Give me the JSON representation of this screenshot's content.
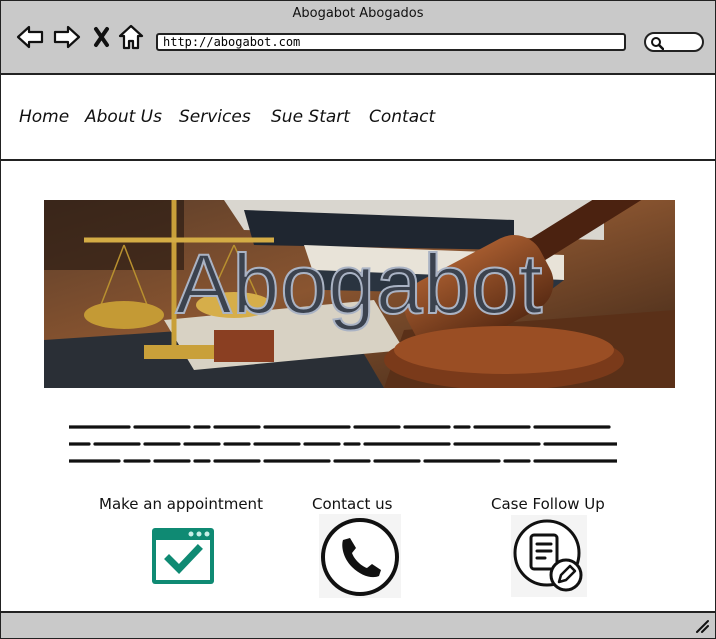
{
  "window": {
    "title": "Abogabot Abogados"
  },
  "toolbar": {
    "back_icon": "arrow-left-icon",
    "forward_icon": "arrow-right-icon",
    "stop_icon": "x-icon",
    "home_icon": "home-icon",
    "url": "http://abogabot.com",
    "search_icon": "search-icon"
  },
  "menu": {
    "items": [
      {
        "label": "Home"
      },
      {
        "label": "About Us"
      },
      {
        "label": "Services"
      },
      {
        "label": "Sue Start"
      },
      {
        "label": "Contact"
      }
    ]
  },
  "hero": {
    "title": "Abogabot",
    "image": "scales-of-justice-books-gavel"
  },
  "features": [
    {
      "label": "Make an appointment",
      "icon": "calendar-check-icon",
      "color": "#0f8a73"
    },
    {
      "label": "Contact us",
      "icon": "phone-icon"
    },
    {
      "label": "Case Follow Up",
      "icon": "document-edit-icon"
    }
  ]
}
